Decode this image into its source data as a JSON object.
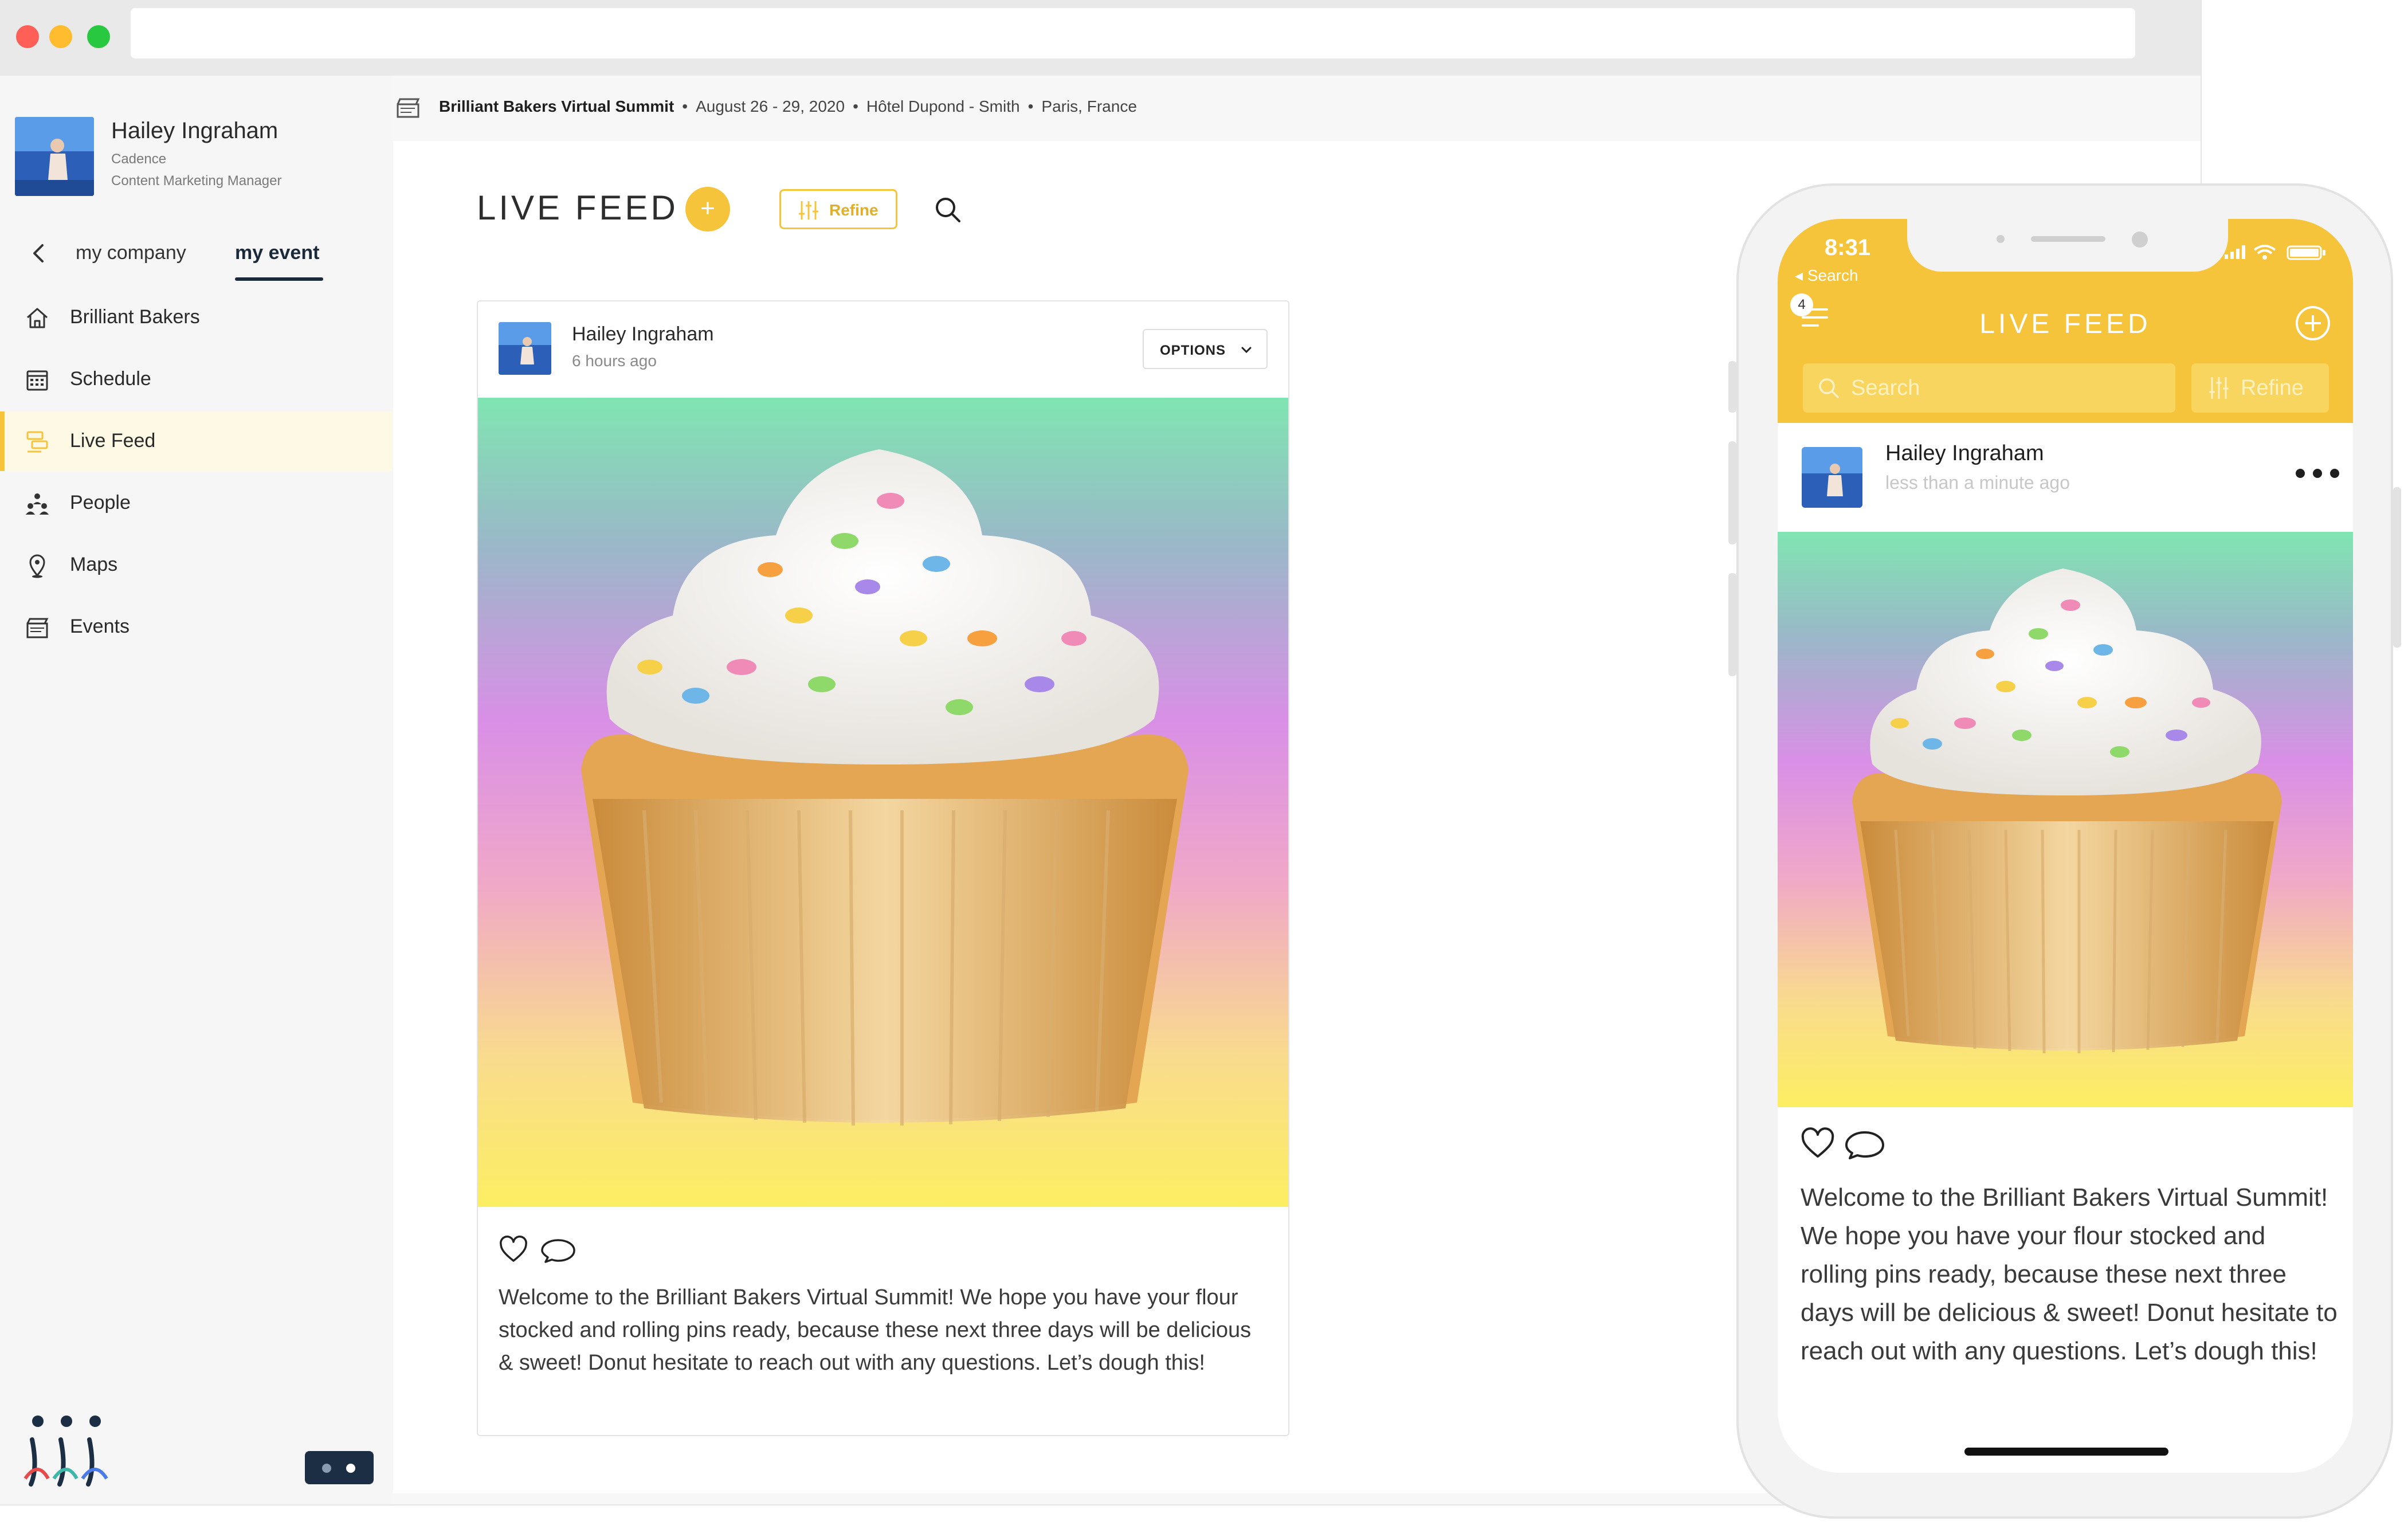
{
  "profile": {
    "name": "Hailey Ingraham",
    "company": "Cadence",
    "role": "Content Marketing Manager"
  },
  "sidebar": {
    "tabs": [
      {
        "label": "my company",
        "active": false
      },
      {
        "label": "my event",
        "active": true
      }
    ],
    "items": [
      {
        "label": "Brilliant Bakers",
        "icon": "home-icon",
        "active": false
      },
      {
        "label": "Schedule",
        "icon": "calendar-icon",
        "active": false
      },
      {
        "label": "Live Feed",
        "icon": "live-feed-icon",
        "active": true
      },
      {
        "label": "People",
        "icon": "people-icon",
        "active": false
      },
      {
        "label": "Maps",
        "icon": "map-pin-icon",
        "active": false
      },
      {
        "label": "Events",
        "icon": "events-icon",
        "active": false
      }
    ]
  },
  "event": {
    "name": "Brilliant Bakers Virtual Summit",
    "dates": "August 26 - 29, 2020",
    "venue": "Hôtel Dupond - Smith",
    "location": "Paris, France"
  },
  "feed": {
    "title": "LIVE FEED",
    "add_label": "+",
    "refine_label": "Refine"
  },
  "post": {
    "author": "Hailey Ingraham",
    "time": "6 hours ago",
    "options_label": "OPTIONS",
    "text": "Welcome to the Brilliant Bakers Virtual Summit! We hope you have your flour stocked and rolling pins ready, because these next three days will be delicious & sweet! Donut hesitate to reach out with any questions. Let’s dough this!"
  },
  "phone": {
    "time": "8:31",
    "back_label": "◂ Search",
    "badge": "4",
    "title": "LIVE FEED",
    "search_placeholder": "Search",
    "refine_label": "Refine",
    "post": {
      "author": "Hailey Ingraham",
      "time": "less than a minute ago",
      "text": "Welcome to the Brilliant Bakers Virtual Summit! We hope you have your flour stocked and rolling pins ready, because these next three days will be delicious & sweet! Donut hesitate to reach out with any questions. Let’s dough this!"
    }
  },
  "colors": {
    "accent": "#f5c43a",
    "dark_navy": "#1c2e44",
    "active_bg": "#fdf9e4"
  }
}
